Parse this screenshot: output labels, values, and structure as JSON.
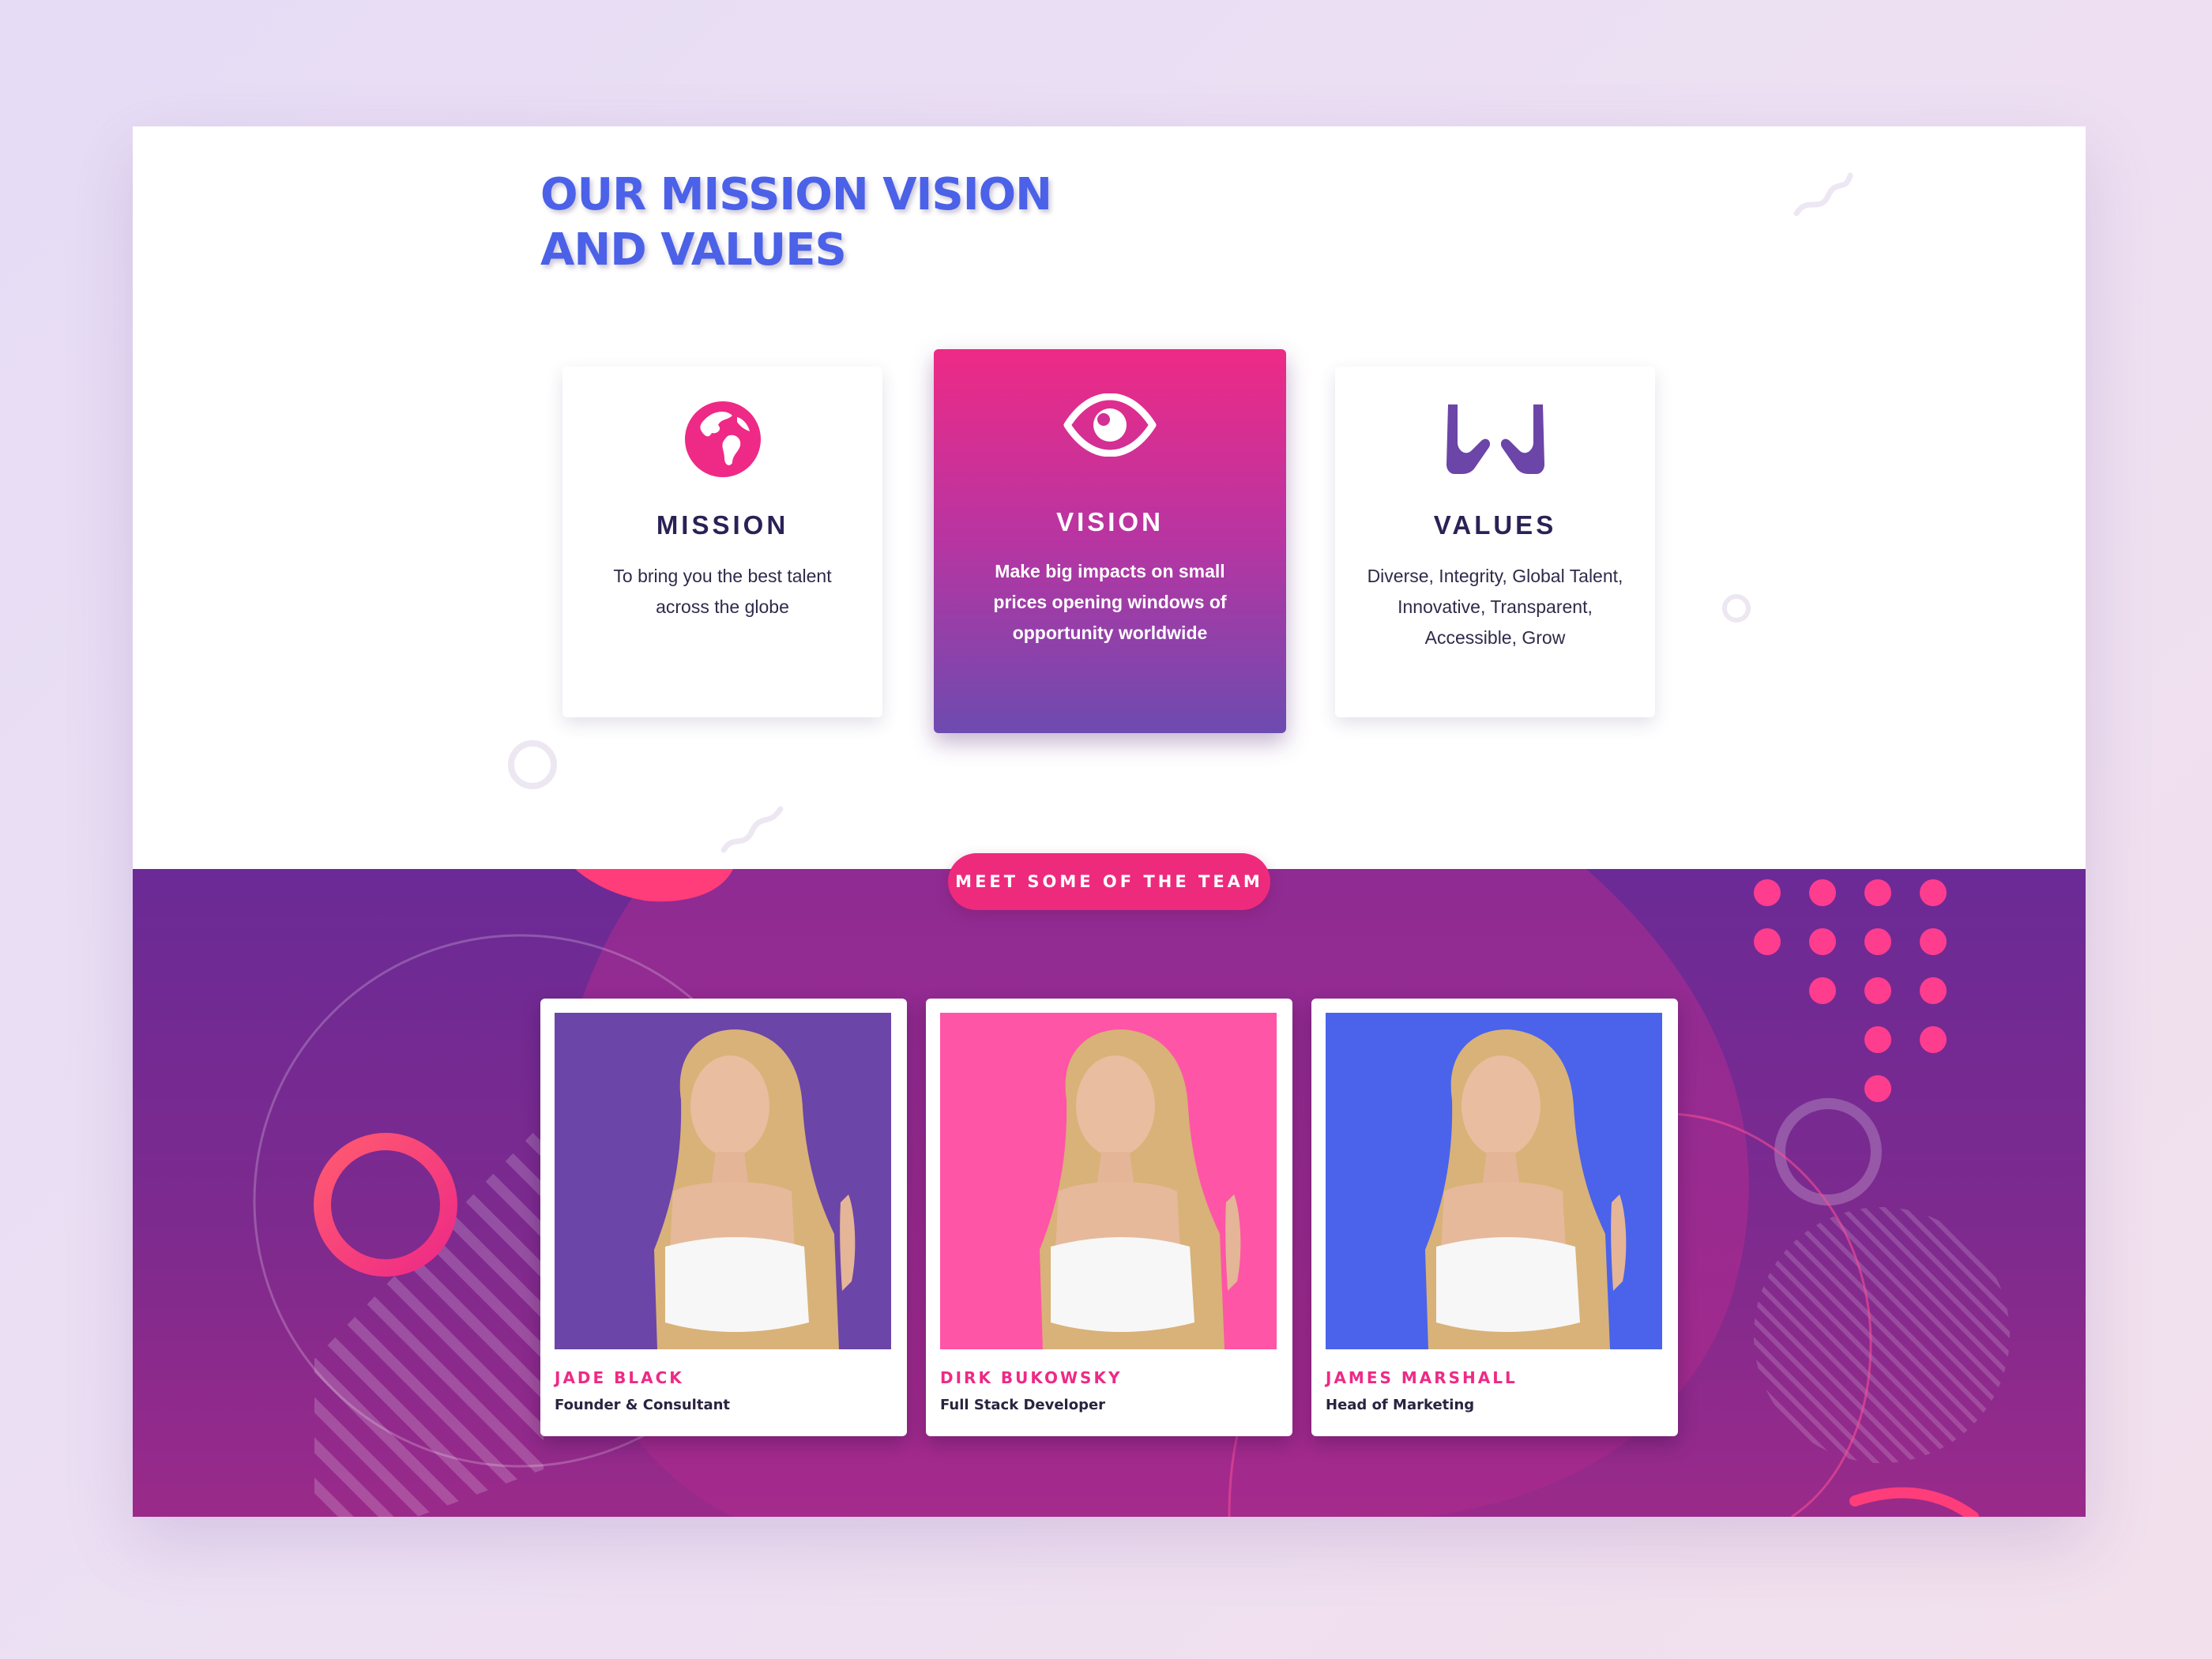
{
  "header": {
    "title_line1": "OUR MISSION VISION",
    "title_line2": "AND VALUES"
  },
  "cards": [
    {
      "icon": "globe-icon",
      "title": "MISSION",
      "text": "To bring you the best talent across the globe"
    },
    {
      "icon": "eye-icon",
      "title": "VISION",
      "text": "Make big impacts on small prices opening windows of opportunity worldwide"
    },
    {
      "icon": "hands-icon",
      "title": "VALUES",
      "text": "Diverse, Integrity, Global Talent, Innovative, Transparent, Accessible, Grow"
    }
  ],
  "team": {
    "badge": "MEET SOME OF THE TEAM",
    "members": [
      {
        "name": "JADE BLACK",
        "role": "Founder & Consultant",
        "photo_bg": "#6b45a8"
      },
      {
        "name": "DIRK BUKOWSKY",
        "role": "Full Stack Developer",
        "photo_bg": "#ff55a6"
      },
      {
        "name": "JAMES MARSHALL",
        "role": "Head of Marketing",
        "photo_bg": "#4a63ea"
      }
    ]
  },
  "colors": {
    "accent_pink": "#ee2a86",
    "title_blue": "#4b61e8",
    "heading_navy": "#2a2255",
    "team_purple": "#6b2a96",
    "values_icon": "#6b45a8"
  }
}
